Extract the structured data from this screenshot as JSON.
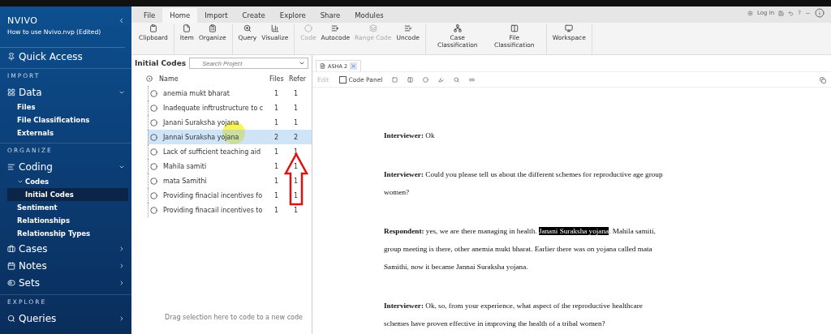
{
  "sidebar": {
    "app_name": "NVIVO",
    "project": "How to use Nvivo.nvp (Edited)",
    "sections": [
      {
        "items": [
          {
            "label": "Quick Access",
            "selected": false
          }
        ]
      },
      {
        "header": "IMPORT",
        "items": [
          {
            "label": "Data",
            "selected": false,
            "expanded": true,
            "children": [
              {
                "label": "Files",
                "selected": false
              },
              {
                "label": "File Classifications",
                "selected": false
              },
              {
                "label": "Externals",
                "selected": false
              }
            ]
          }
        ]
      },
      {
        "header": "ORGANIZE",
        "items": [
          {
            "label": "Coding",
            "selected": false,
            "expanded": true,
            "children": [
              {
                "label": "Codes",
                "selected": false,
                "expanded": true,
                "children": [
                  {
                    "label": "Initial Codes",
                    "selected": true
                  }
                ]
              },
              {
                "label": "Sentiment",
                "selected": false
              },
              {
                "label": "Relationships",
                "selected": false
              },
              {
                "label": "Relationship Types",
                "selected": false
              }
            ]
          },
          {
            "label": "Cases",
            "selected": false,
            "expanded": false
          },
          {
            "label": "Notes",
            "selected": false,
            "expanded": false
          },
          {
            "label": "Sets",
            "selected": false,
            "expanded": false
          }
        ]
      },
      {
        "header": "EXPLORE",
        "items": [
          {
            "label": "Queries",
            "selected": false,
            "expanded": false
          }
        ]
      }
    ]
  },
  "menu": {
    "tabs": [
      {
        "label": "File",
        "selected": false
      },
      {
        "label": "Home",
        "selected": true
      },
      {
        "label": "Import",
        "selected": false
      },
      {
        "label": "Create",
        "selected": false
      },
      {
        "label": "Explore",
        "selected": false
      },
      {
        "label": "Share",
        "selected": false
      },
      {
        "label": "Modules",
        "selected": false
      }
    ],
    "login": "Log In",
    "help": "?"
  },
  "ribbon": {
    "groups": [
      [
        {
          "label": "Clipboard",
          "disabled": false
        }
      ],
      [
        {
          "label": "Item",
          "disabled": false
        },
        {
          "label": "Organize",
          "disabled": false
        }
      ],
      [
        {
          "label": "Query",
          "disabled": false
        },
        {
          "label": "Visualize",
          "disabled": false
        }
      ],
      [
        {
          "label": "Code",
          "disabled": true
        },
        {
          "label": "Autocode",
          "disabled": false
        },
        {
          "label": "Range Code",
          "disabled": true
        },
        {
          "label": "Uncode",
          "disabled": false
        }
      ],
      [
        {
          "label": "Case Classification",
          "disabled": false
        },
        {
          "label": "File Classification",
          "disabled": false
        }
      ],
      [
        {
          "label": "Workspace",
          "disabled": false
        }
      ]
    ]
  },
  "codes_pane": {
    "title": "Initial Codes",
    "search": {
      "placeholder": "Search Project"
    },
    "columns": [
      "Name",
      "Files",
      "Refer"
    ],
    "rows": [
      {
        "name": "anemia mukt bharat",
        "files": "1",
        "refs": "1",
        "selected": false
      },
      {
        "name": "Inadequate inftrustructure to c",
        "files": "1",
        "refs": "1",
        "selected": false
      },
      {
        "name": "Janani Suraksha yojana",
        "files": "1",
        "refs": "1",
        "selected": false
      },
      {
        "name": "Jannai Suraksha yojana",
        "files": "2",
        "refs": "2",
        "selected": true
      },
      {
        "name": "Lack of sufficient  teaching aid",
        "files": "1",
        "refs": "1",
        "selected": false
      },
      {
        "name": "Mahila samiti",
        "files": "1",
        "refs": "1",
        "selected": false
      },
      {
        "name": "mata Samithi",
        "files": "1",
        "refs": "1",
        "selected": false
      },
      {
        "name": "Providing  finacial incentives fo",
        "files": "1",
        "refs": "1",
        "selected": false
      },
      {
        "name": "Providing finacail incentives to",
        "files": "1",
        "refs": "1",
        "selected": false
      }
    ],
    "drop_hint": "Drag selection here to code to a new code"
  },
  "document": {
    "tab": "ASHA 2",
    "toolbar": {
      "edit": {
        "label": "Edit",
        "disabled": true
      },
      "code_panel": {
        "label": "Code Panel",
        "checked": false
      }
    },
    "paragraphs": [
      {
        "speaker": "Interviewer:",
        "segments": [
          {
            "text": " Ok",
            "highlighted": false
          }
        ]
      },
      {
        "speaker": "Interviewer:",
        "segments": [
          {
            "text": " Could you please tell us about the different schemes for reproductive age group women?",
            "highlighted": false
          }
        ]
      },
      {
        "speaker": "Respondent:",
        "segments": [
          {
            "text": " yes, we are there managing in health. ",
            "highlighted": false
          },
          {
            "text": "Janani Suraksha yojana",
            "highlighted": true
          },
          {
            "text": ". Mahila samiti, group meeting is there, other anemia mukt bharat. Earlier there was on yojana called mata Samithi, now it became Jannai Suraksha yojana.",
            "highlighted": false
          }
        ]
      },
      {
        "speaker": "Interviewer:",
        "segments": [
          {
            "text": " Ok, so, from your experience, what aspect of the reproductive healthcare schemes have proven effective in improving the health of a tribal women?",
            "highlighted": false
          }
        ]
      }
    ]
  }
}
